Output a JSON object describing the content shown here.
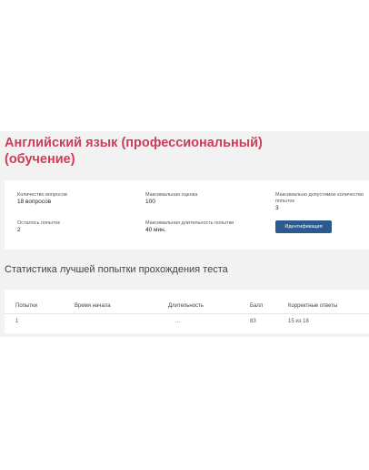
{
  "course": {
    "title": "Английский язык (профессиональный) (обучение)"
  },
  "info": {
    "questions_label": "Количество вопросов",
    "questions_value": "18 вопросов",
    "max_score_label": "Максимальная оценка",
    "max_score_value": "100",
    "max_attempts_label": "Максимально допустимое количество попыток",
    "max_attempts_value": "3",
    "attempts_left_label": "Осталось попыток",
    "attempts_left_value": "2",
    "max_duration_label": "Максимальная длительность попытки",
    "max_duration_value": "40 мин.",
    "identify_button": "Идентификация"
  },
  "stats": {
    "heading": "Статистика лучшей попытки прохождения теста",
    "columns": [
      "Попытки",
      "Время начала",
      "Длительность",
      "Балл",
      "Корректные ответы"
    ],
    "rows": [
      [
        "1",
        "",
        "...",
        "83",
        "15 из 18"
      ]
    ]
  },
  "colors": {
    "title": "#cc3e57",
    "button": "#2b5a8e",
    "panel_bg": "#f2f2f2"
  }
}
